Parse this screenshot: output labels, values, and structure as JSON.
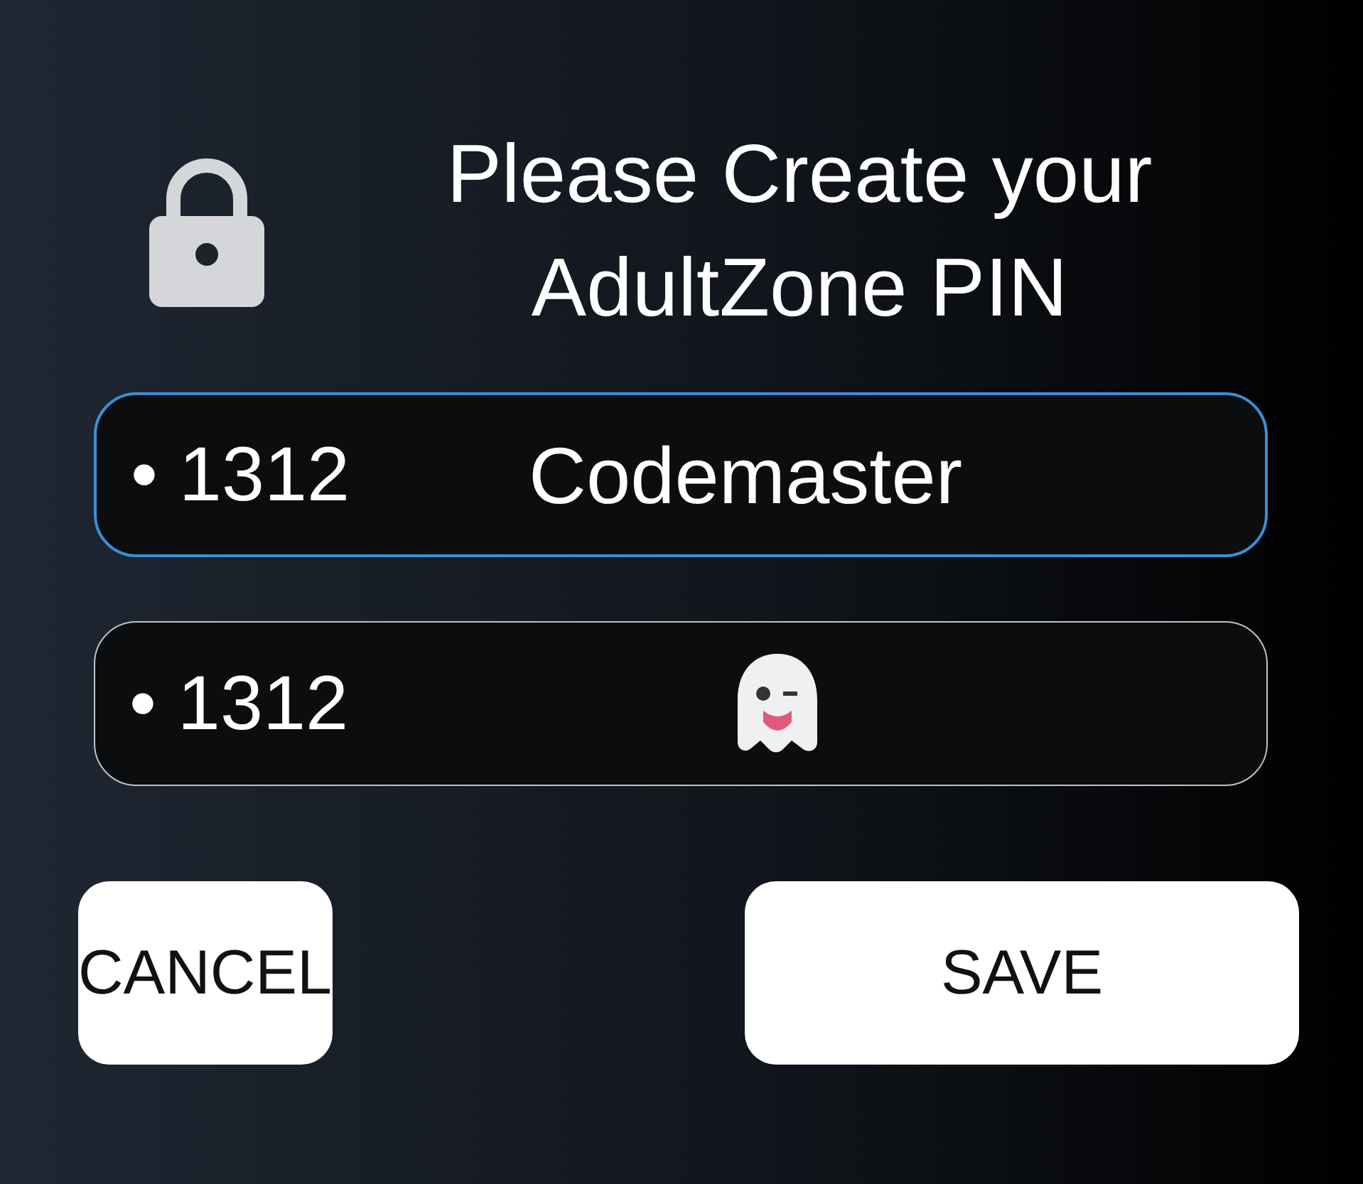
{
  "header": {
    "title": "Please Create your AdultZone PIN"
  },
  "fields": [
    {
      "kind": "text",
      "value": "• 1312",
      "label": "Codemaster",
      "focused": true
    },
    {
      "kind": "icon",
      "value": "• 1312",
      "focused": false
    }
  ],
  "buttons": [
    {
      "label": "CANCEL"
    },
    {
      "label": "SAVE"
    }
  ]
}
